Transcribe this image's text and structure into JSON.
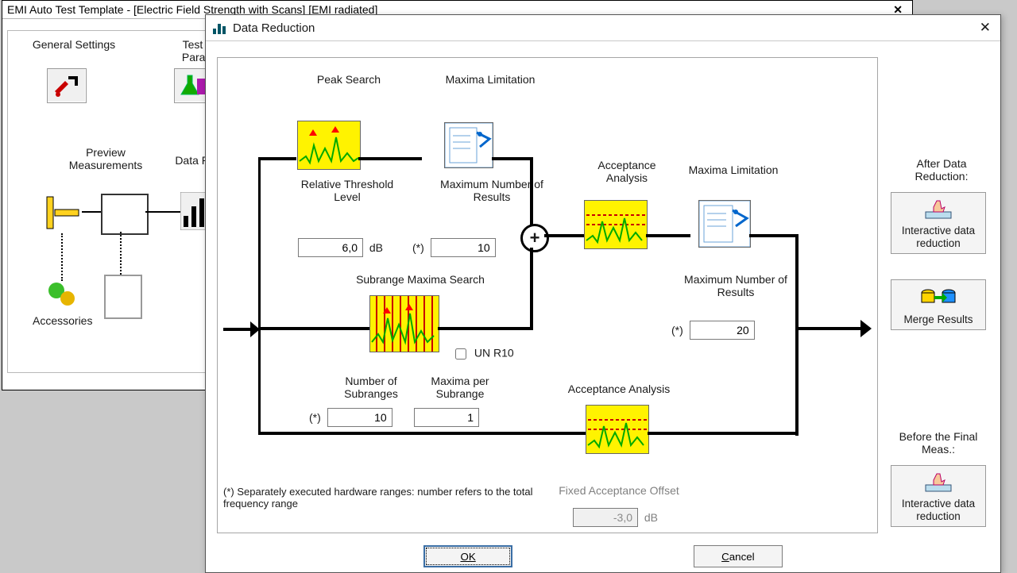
{
  "bgwin": {
    "title": "EMI Auto Test Template - [Electric Field Strength with Scans] [EMI radiated]",
    "general_settings": "General Settings",
    "test_specific": "Test Sp",
    "params": "Params",
    "preview": "Preview",
    "measurements": "Measurements",
    "data_re": "Data Re",
    "accessories": "Accessories"
  },
  "dlg": {
    "title": "Data Reduction",
    "peak_search": "Peak Search",
    "maxima_limitation": "Maxima Limitation",
    "relative_threshold": "Relative Threshold",
    "level": "Level",
    "relative_threshold_value": "6,0",
    "db": "dB",
    "max_num_results": "Maximum Number of",
    "results": "Results",
    "max_results_value": "10",
    "asterisk": "(*)",
    "subrange_search": "Subrange Maxima Search",
    "un_r10": "UN R10",
    "num_subranges": "Number of",
    "subranges_word": "Subranges",
    "num_subranges_value": "10",
    "maxima_per": "Maxima per",
    "subrange_word": "Subrange",
    "maxima_per_value": "1",
    "acceptance_analysis": "Acceptance",
    "analysis_word": "Analysis",
    "maxima_limitation2": "Maxima Limitation",
    "max_results2": "20",
    "acceptance_analysis2": "Acceptance Analysis",
    "fixed_offset": "Fixed Acceptance Offset",
    "fixed_offset_value": "-3,0",
    "footnote": "(*) Separately executed hardware ranges: number refers to the total frequency range",
    "ok": "OK",
    "cancel": "Cancel",
    "after_dr": "After Data",
    "after_dr2": "Reduction:",
    "interactive_dr": "Interactive data",
    "reduction_word": "reduction",
    "merge_results": "Merge Results",
    "before_final": "Before the Final",
    "meas": "Meas.:"
  }
}
